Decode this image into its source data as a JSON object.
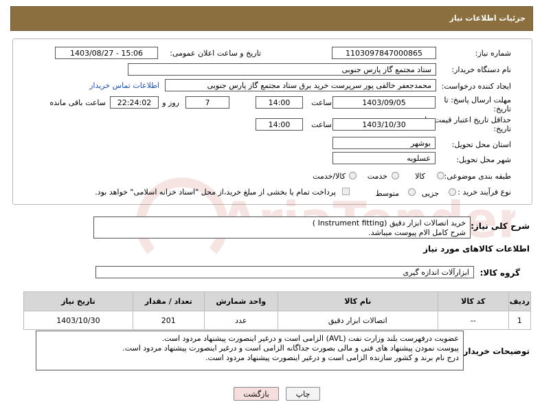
{
  "header": {
    "title": "جزئیات اطلاعات نیاز"
  },
  "form": {
    "need_number_label": "شماره نیاز:",
    "need_number": "1103097847000865",
    "announce_label": "تاریخ و ساعت اعلان عمومی:",
    "announce_value": "1403/08/27 - 15:06",
    "buyer_org_label": "نام دستگاه خریدار:",
    "buyer_org": "ستاد مجتمع گاز پارس جنوبی",
    "creator_label": "ایجاد کننده درخواست:",
    "creator": "محمدجعفر خالقی پور سرپرست خرید برق ستاد مجتمع گاز پارس جنوبی",
    "contact_link": "اطلاعات تماس خریدار",
    "deadline_label_1": "مهلت ارسال پاسخ: تا",
    "deadline_label_2": "تاریخ:",
    "deadline_date": "1403/09/05",
    "time_label": "ساعت",
    "deadline_time": "14:00",
    "days_value": "7",
    "days_label": "روز و",
    "remaining_time": "22:24:02",
    "remaining_label": "ساعت باقی مانده",
    "validity_label_1": "حداقل تاریخ اعتبار قیمت: تا",
    "validity_label_2": "تاریخ:",
    "validity_date": "1403/10/30",
    "validity_time": "14:00",
    "province_label": "استان محل تحویل:",
    "province": "بوشهر",
    "city_label": "شهر محل تحویل:",
    "city": "عسلویه",
    "category_label": "طبقه بندی موضوعی:",
    "category_options": [
      "کالا",
      "خدمت",
      "کالا/خدمت"
    ],
    "category_selected": "کالا",
    "process_label": "نوع فرآیند خرید :",
    "process_options": [
      "جزیی",
      "متوسط"
    ],
    "payment_note": "پرداخت تمام یا بخشی از مبلغ خرید،از محل \"اسناد خزانه اسلامی\" خواهد بود."
  },
  "summary": {
    "label": "شرح کلی نیاز:",
    "line1": "خرید اتصالات ابزار دقیق  (Instrument fitting )",
    "line2": "شرح کامل الام پیوست میباشد."
  },
  "goods_section_title": "اطلاعات کالاهای مورد نیاز",
  "goods_group": {
    "label": "گروه کالا:",
    "value": "ابزارآلات اندازه گیری"
  },
  "table": {
    "headers": [
      "ردیف",
      "کد کالا",
      "نام کالا",
      "واحد شمارش",
      "تعداد / مقدار",
      "تاریخ نیاز"
    ],
    "rows": [
      [
        "1",
        "--",
        "اتصالات ابزار دقیق",
        "عدد",
        "201",
        "1403/10/30"
      ]
    ]
  },
  "buyer_notes": {
    "label": "توضیحات خریدار:",
    "line1": "عضویت درفهرست بلند وزارت نفت (AVL) الزامی است و درغیر اینصورت پیشنهاد مردود است.",
    "line2": "پیوست نمودن پیشنهاد های فنی و مالی بصورت جداگانه الزامی است و درغیر اینصورت پیشنهاد مردود است.",
    "line3": "درج نام برند و کشور سازنده الزامی است و درغیر اینصورت پیشنهاد مردود است."
  },
  "buttons": {
    "print": "چاپ",
    "back": "بازگشت"
  },
  "watermark": {
    "text": "AriaTender.neT"
  },
  "colors": {
    "header_bg": "#8b6f3e",
    "back_button_bg": "#f7dede"
  }
}
